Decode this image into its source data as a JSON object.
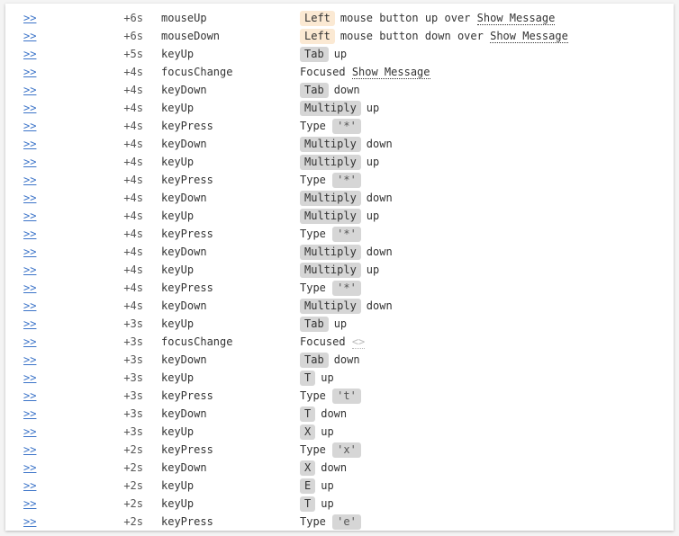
{
  "link_label": ">>",
  "rows": [
    {
      "time": "+6s",
      "event": "mouseUp",
      "kind": "mouse",
      "key": "Left",
      "text": "mouse button up over",
      "target": "Show Message"
    },
    {
      "time": "+6s",
      "event": "mouseDown",
      "kind": "mouse",
      "key": "Left",
      "text": "mouse button down over",
      "target": "Show Message"
    },
    {
      "time": "+5s",
      "event": "keyUp",
      "kind": "key",
      "key": "Tab",
      "text": "up"
    },
    {
      "time": "+4s",
      "event": "focusChange",
      "kind": "focus",
      "text": "Focused",
      "target": "Show Message"
    },
    {
      "time": "+4s",
      "event": "keyDown",
      "kind": "key",
      "key": "Tab",
      "text": "down"
    },
    {
      "time": "+4s",
      "event": "keyUp",
      "kind": "key",
      "key": "Multiply",
      "text": "up"
    },
    {
      "time": "+4s",
      "event": "keyPress",
      "kind": "press",
      "text": "Type",
      "key": "'*'"
    },
    {
      "time": "+4s",
      "event": "keyDown",
      "kind": "key",
      "key": "Multiply",
      "text": "down"
    },
    {
      "time": "+4s",
      "event": "keyUp",
      "kind": "key",
      "key": "Multiply",
      "text": "up"
    },
    {
      "time": "+4s",
      "event": "keyPress",
      "kind": "press",
      "text": "Type",
      "key": "'*'"
    },
    {
      "time": "+4s",
      "event": "keyDown",
      "kind": "key",
      "key": "Multiply",
      "text": "down"
    },
    {
      "time": "+4s",
      "event": "keyUp",
      "kind": "key",
      "key": "Multiply",
      "text": "up"
    },
    {
      "time": "+4s",
      "event": "keyPress",
      "kind": "press",
      "text": "Type",
      "key": "'*'"
    },
    {
      "time": "+4s",
      "event": "keyDown",
      "kind": "key",
      "key": "Multiply",
      "text": "down"
    },
    {
      "time": "+4s",
      "event": "keyUp",
      "kind": "key",
      "key": "Multiply",
      "text": "up"
    },
    {
      "time": "+4s",
      "event": "keyPress",
      "kind": "press",
      "text": "Type",
      "key": "'*'"
    },
    {
      "time": "+4s",
      "event": "keyDown",
      "kind": "key",
      "key": "Multiply",
      "text": "down"
    },
    {
      "time": "+3s",
      "event": "keyUp",
      "kind": "key",
      "key": "Tab",
      "text": "up"
    },
    {
      "time": "+3s",
      "event": "focusChange",
      "kind": "focus",
      "text": "Focused",
      "target": "<>",
      "empty": true
    },
    {
      "time": "+3s",
      "event": "keyDown",
      "kind": "key",
      "key": "Tab",
      "text": "down"
    },
    {
      "time": "+3s",
      "event": "keyUp",
      "kind": "key",
      "key": "T",
      "text": "up"
    },
    {
      "time": "+3s",
      "event": "keyPress",
      "kind": "press",
      "text": "Type",
      "key": "'t'"
    },
    {
      "time": "+3s",
      "event": "keyDown",
      "kind": "key",
      "key": "T",
      "text": "down"
    },
    {
      "time": "+3s",
      "event": "keyUp",
      "kind": "key",
      "key": "X",
      "text": "up"
    },
    {
      "time": "+2s",
      "event": "keyPress",
      "kind": "press",
      "text": "Type",
      "key": "'x'"
    },
    {
      "time": "+2s",
      "event": "keyDown",
      "kind": "key",
      "key": "X",
      "text": "down"
    },
    {
      "time": "+2s",
      "event": "keyUp",
      "kind": "key",
      "key": "E",
      "text": "up"
    },
    {
      "time": "+2s",
      "event": "keyUp",
      "kind": "key",
      "key": "T",
      "text": "up"
    },
    {
      "time": "+2s",
      "event": "keyPress",
      "kind": "press",
      "text": "Type",
      "key": "'e'"
    }
  ],
  "colors": {
    "link": "#3b73c8",
    "key_badge": "#d6d6d6",
    "mouse_badge": "#fbe9d3"
  }
}
